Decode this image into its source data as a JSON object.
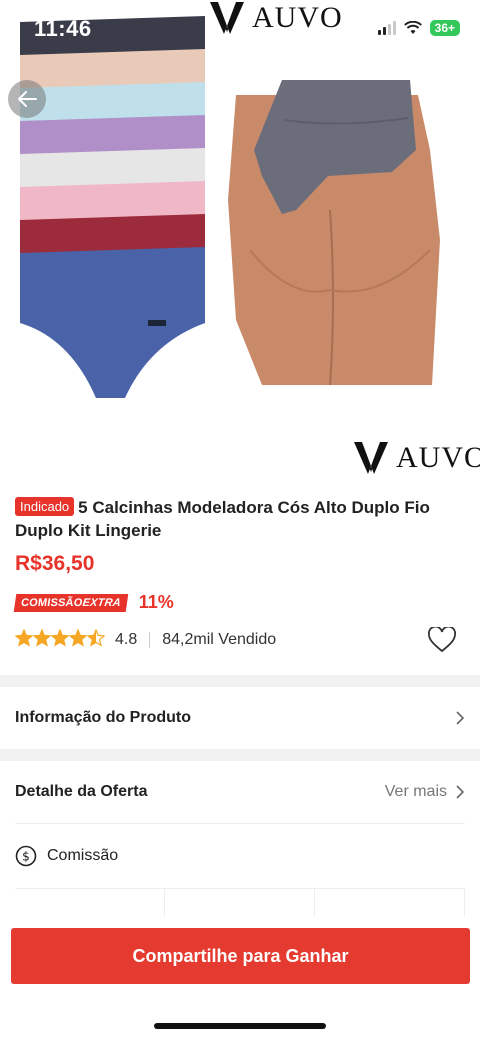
{
  "status_bar": {
    "time": "11:46",
    "battery": "36+"
  },
  "brand": {
    "name": "AUVO"
  },
  "product": {
    "badge": "Indicado",
    "title": "5 Calcinhas Modeladora Cós Alto Duplo Fio Duplo Kit Lingerie",
    "price": "R$36,50",
    "commission_tag_prefix": "COMISSÃO",
    "commission_tag_suffix": "EXTRA",
    "commission_pct": "11%",
    "rating": "4.8",
    "rating_value": 4.5,
    "sold": "84,2mil Vendido"
  },
  "sections": {
    "product_info": "Informação do Produto",
    "offer_detail": "Detalhe da Oferta",
    "see_more": "Ver mais",
    "commission": "Comissão"
  },
  "cta": {
    "label": "Compartilhe para Ganhar"
  },
  "colors": {
    "accent": "#e8332a",
    "star": "#f5a623",
    "panty_colors": [
      "#3a3c4a",
      "#e9c9b8",
      "#bfe0ea",
      "#b08fc8",
      "#e6e6e6",
      "#f0b8c6",
      "#9c2c3c",
      "#4a62a8"
    ],
    "model_panty": "#6b6d7b",
    "skin": "#c98a6a"
  },
  "icons": {
    "back": "arrow-left-icon",
    "favorite": "heart-outline-icon",
    "chevron": "chevron-right-icon",
    "commission": "dollar-circle-icon"
  }
}
